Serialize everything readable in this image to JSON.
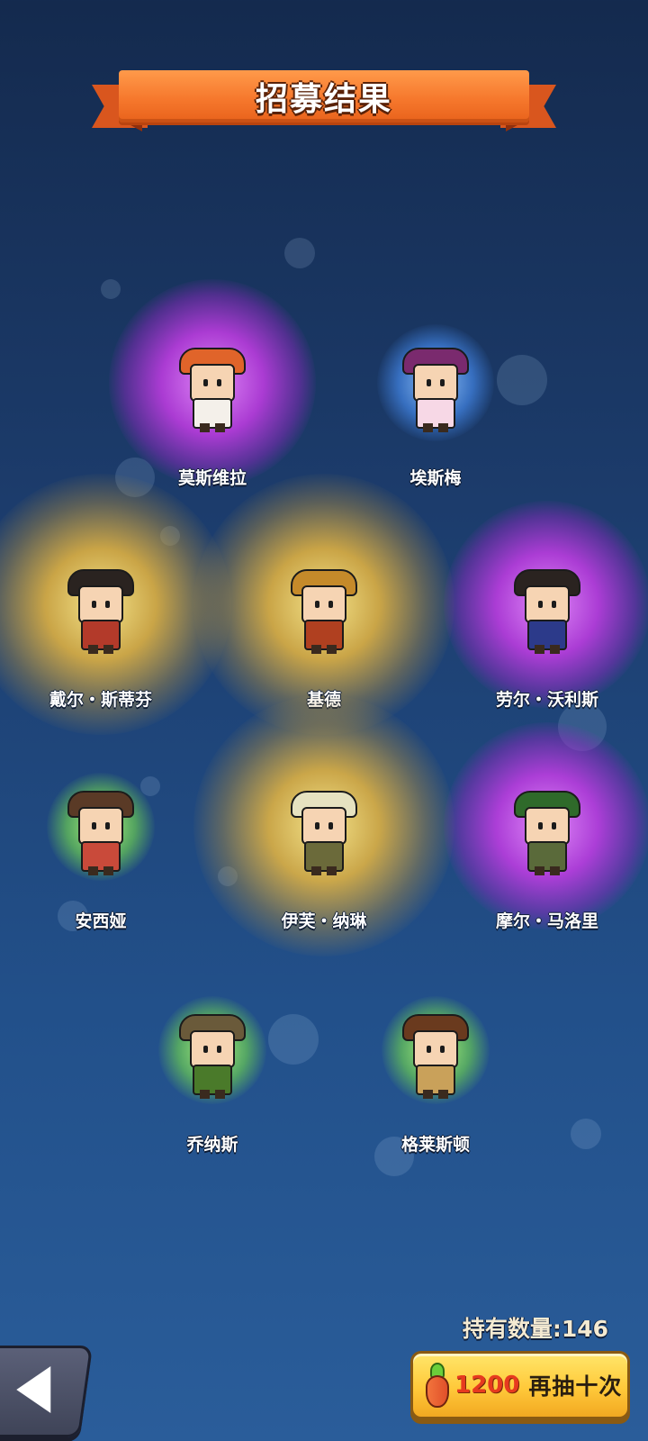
{
  "header": {
    "title": "招募结果"
  },
  "characters": [
    {
      "name": "莫斯维拉",
      "rarity": "purple",
      "hat_color": "#e0642a",
      "body_color": "#f4f0ea"
    },
    {
      "name": "埃斯梅",
      "rarity": "blue",
      "hat_color": "#7a2a6e",
      "body_color": "#f7d8e6"
    },
    {
      "name": "戴尔・斯蒂芬",
      "rarity": "gold",
      "hat_color": "#2a2320",
      "body_color": "#b33a2a"
    },
    {
      "name": "基德",
      "rarity": "gold",
      "hat_color": "#c58a2a",
      "body_color": "#b04020"
    },
    {
      "name": "劳尔・沃利斯",
      "rarity": "purple",
      "hat_color": "#2a2320",
      "body_color": "#2c3a8a"
    },
    {
      "name": "安西娅",
      "rarity": "green",
      "hat_color": "#5a3a26",
      "body_color": "#c94a3a"
    },
    {
      "name": "伊芙・纳琳",
      "rarity": "gold",
      "hat_color": "#e6e2c0",
      "body_color": "#6b6a3a"
    },
    {
      "name": "摩尔・马洛里",
      "rarity": "purple",
      "hat_color": "#2f6a2a",
      "body_color": "#5a6a3a"
    },
    {
      "name": "乔纳斯",
      "rarity": "green",
      "hat_color": "#6a5a3a",
      "body_color": "#4a7a2a"
    },
    {
      "name": "格莱斯顿",
      "rarity": "green",
      "hat_color": "#6a3a1e",
      "body_color": "#c9a15a"
    }
  ],
  "footer": {
    "held_label": "持有数量:",
    "held_value": "146",
    "draw_cost": "1200",
    "draw_label": "再抽十次",
    "currency_icon": "carrot-icon",
    "back_icon": "back-arrow-icon"
  },
  "colors": {
    "accent": "#f6782d",
    "button_gold": "#ffc93a",
    "cost_red": "#e73a1f"
  }
}
